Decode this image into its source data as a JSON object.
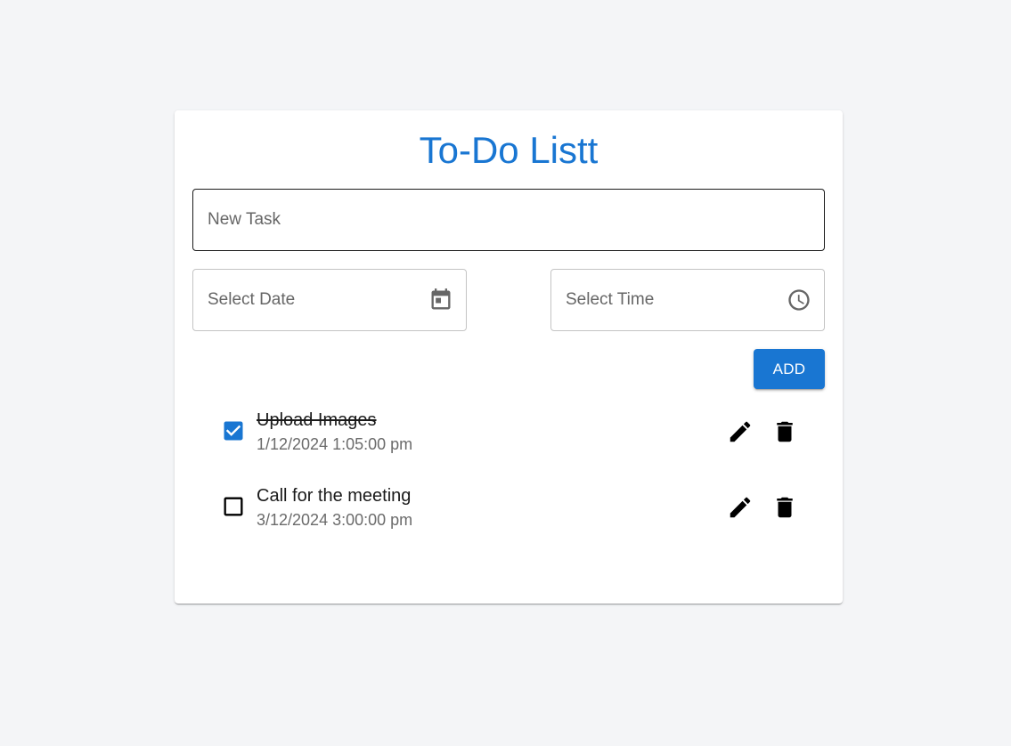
{
  "app": {
    "title": "To-Do Listt"
  },
  "form": {
    "task_placeholder": "New Task",
    "date_placeholder": "Select Date",
    "time_placeholder": "Select Time",
    "add_label": "ADD"
  },
  "tasks": [
    {
      "name": "Upload Images",
      "datetime": "1/12/2024 1:05:00 pm",
      "completed": true
    },
    {
      "name": "Call for the meeting",
      "datetime": "3/12/2024 3:00:00 pm",
      "completed": false
    }
  ],
  "colors": {
    "accent": "#1976d2",
    "background": "#f4f5f7"
  },
  "icons": {
    "date": "calendar-icon",
    "time": "clock-icon",
    "edit": "pencil-icon",
    "delete": "trash-icon"
  }
}
